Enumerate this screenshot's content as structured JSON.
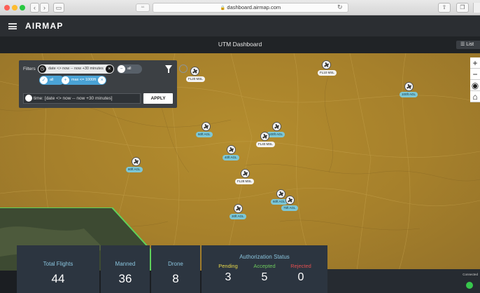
{
  "browser": {
    "url": "dashboard.airmap.com",
    "reader_label": "ᴬᴬ"
  },
  "app": {
    "name": "AIRMAP",
    "page_title": "UTM Dashboard",
    "list_button": "☰  List"
  },
  "filters": {
    "label": "Filters",
    "chips": [
      {
        "text": "date <> now -- now +30 minutes"
      },
      {
        "text": "all"
      },
      {
        "text": "all"
      },
      {
        "text": "max <= 1000ft"
      }
    ],
    "time_value": "time: [date <> now -- now +30 minutes]",
    "apply_label": "APPLY"
  },
  "map": {
    "controls": [
      "+",
      "−",
      "◉",
      "⌂"
    ],
    "flights": [
      {
        "label": "FL20 MSL",
        "kind": "msl"
      },
      {
        "label": "FL10 MSL",
        "kind": "msl"
      },
      {
        "label": "100ft AGL",
        "kind": "agl"
      },
      {
        "label": "60ft AGL",
        "kind": "agl"
      },
      {
        "label": "100ft AGL",
        "kind": "agl"
      },
      {
        "label": "FL40 MSL",
        "kind": "msl"
      },
      {
        "label": "40ft AGL",
        "kind": "agl"
      },
      {
        "label": "80ft AGL",
        "kind": "agl"
      },
      {
        "label": "FL28 MSL",
        "kind": "msl"
      },
      {
        "label": "60ft AGL",
        "kind": "agl"
      },
      {
        "label": "75ft AGL",
        "kind": "agl"
      },
      {
        "label": "30ft AGL",
        "kind": "agl"
      }
    ]
  },
  "stats": {
    "total_flights": {
      "label": "Total Flights",
      "value": "44"
    },
    "manned": {
      "label": "Manned",
      "value": "36"
    },
    "drone": {
      "label": "Drone",
      "value": "8"
    }
  },
  "authorization": {
    "title": "Authorization Status",
    "pending": {
      "label": "Pending",
      "value": "3",
      "color": "#e7d84a"
    },
    "accepted": {
      "label": "Accepted",
      "value": "5",
      "color": "#6dc95c"
    },
    "rejected": {
      "label": "Rejected",
      "value": "0",
      "color": "#e24f4f"
    }
  },
  "status": {
    "connection": "Connected",
    "connection_color": "#37c64c"
  }
}
